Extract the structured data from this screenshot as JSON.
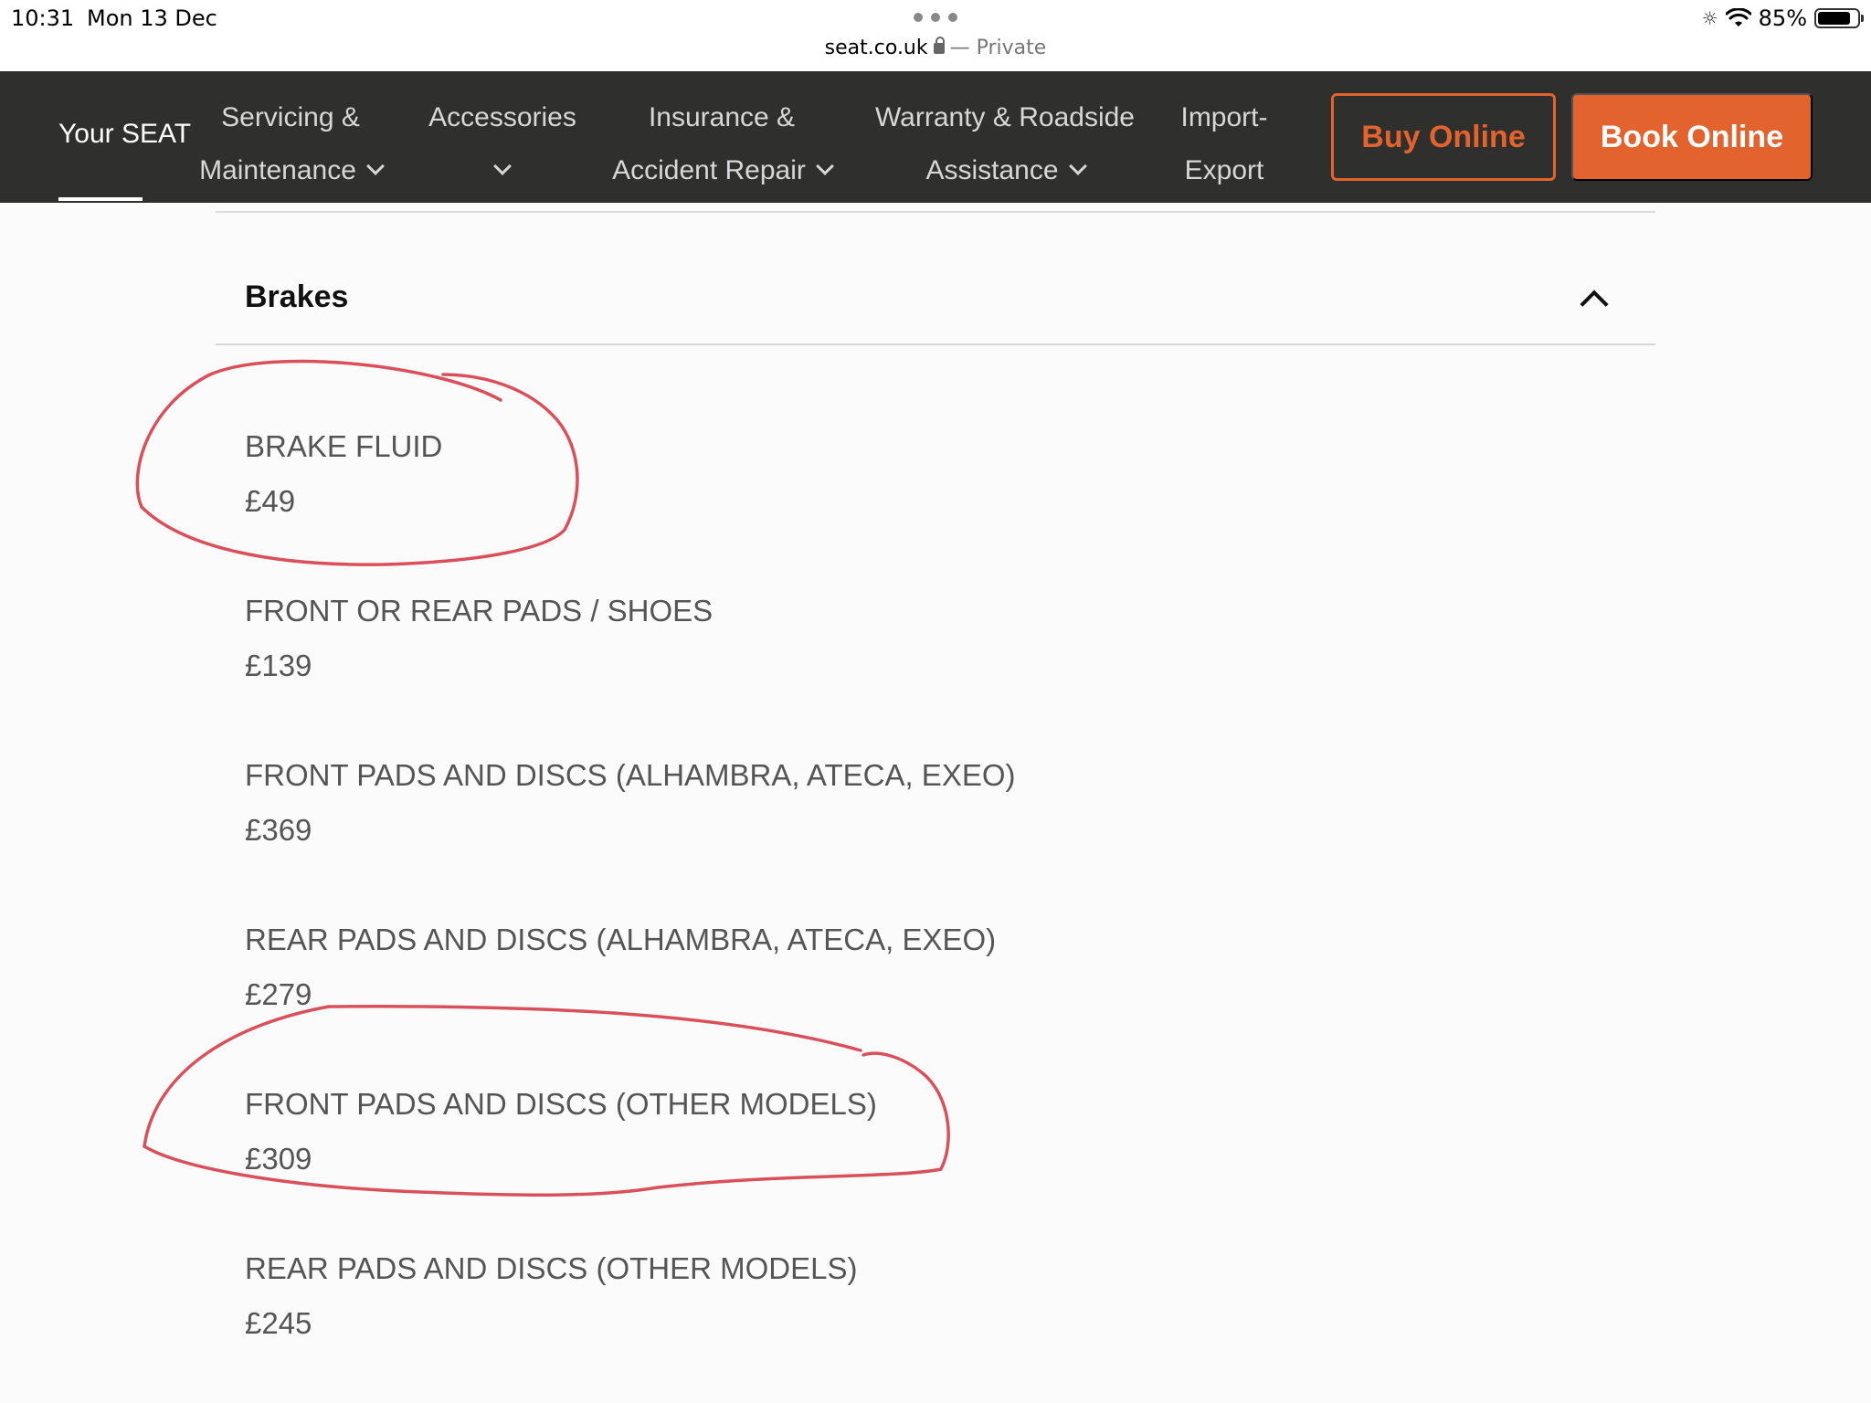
{
  "status_bar": {
    "time": "10:31",
    "date": "Mon 13 Dec",
    "battery": "85%",
    "battery_level": 0.85,
    "icons": [
      "brightness-icon",
      "wifi-icon",
      "battery-icon"
    ]
  },
  "browser": {
    "domain": "seat.co.uk",
    "private_label": "— Private"
  },
  "nav": {
    "brand": "Your SEAT",
    "items": [
      {
        "line1": "Servicing &",
        "line2": "Maintenance",
        "chevron": true
      },
      {
        "line1": "Accessories",
        "line2": "",
        "chevron": true
      },
      {
        "line1": "Insurance &",
        "line2": "Accident Repair",
        "chevron": true
      },
      {
        "line1": "Warranty & Roadside",
        "line2": "Assistance",
        "chevron": true
      },
      {
        "line1": "Import-",
        "line2": "Export",
        "chevron": false
      }
    ],
    "buy_label": "Buy Online",
    "book_label": "Book Online"
  },
  "section": {
    "title": "Brakes",
    "items": [
      {
        "name": "BRAKE FLUID",
        "price": "£49"
      },
      {
        "name": "FRONT OR REAR PADS / SHOES",
        "price": "£139"
      },
      {
        "name": "FRONT PADS AND DISCS (ALHAMBRA, ATECA, EXEO)",
        "price": "£369"
      },
      {
        "name": "REAR PADS AND DISCS (ALHAMBRA, ATECA, EXEO)",
        "price": "£279"
      },
      {
        "name": "FRONT PADS AND DISCS (OTHER MODELS)",
        "price": "£309"
      },
      {
        "name": "REAR PADS AND DISCS (OTHER MODELS)",
        "price": "£245"
      }
    ]
  },
  "colors": {
    "nav_bg": "#2f2f2e",
    "accent": "#e2632d",
    "annotation": "#d9505a"
  }
}
